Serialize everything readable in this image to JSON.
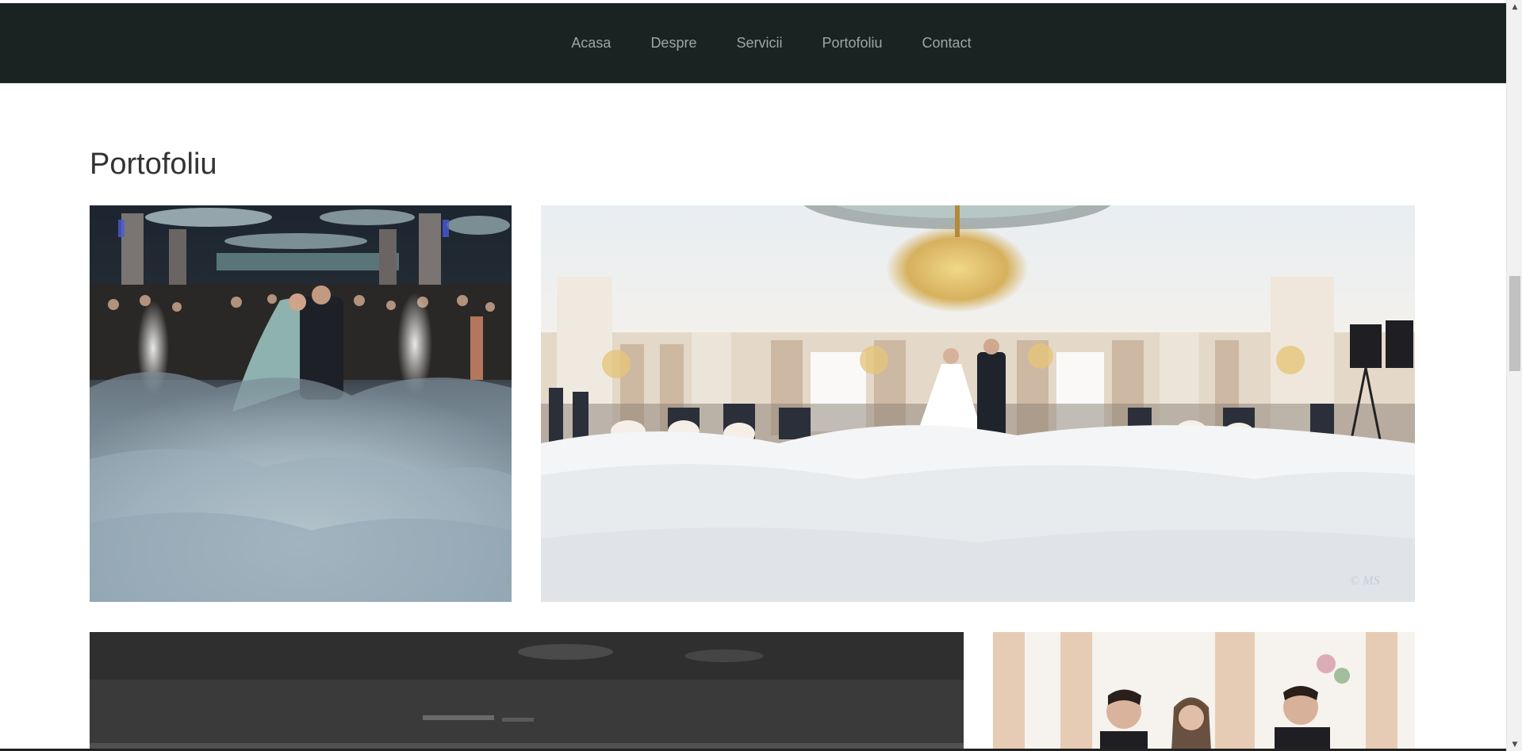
{
  "nav": {
    "items": [
      {
        "label": "Acasa"
      },
      {
        "label": "Despre"
      },
      {
        "label": "Servicii"
      },
      {
        "label": "Portofoliu"
      },
      {
        "label": "Contact"
      }
    ]
  },
  "portfolio": {
    "title": "Portofoliu"
  },
  "colors": {
    "navbar_bg": "#1a2222",
    "nav_text": "#9ea5a5",
    "title_text": "#333333"
  }
}
